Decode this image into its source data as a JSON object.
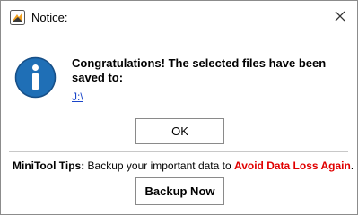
{
  "window": {
    "title": "Notice:"
  },
  "dialog": {
    "message": "Congratulations! The selected files have been saved to:",
    "path": "J:\\",
    "ok_label": "OK"
  },
  "tips": {
    "label": "MiniTool Tips:",
    "text": " Backup your important data to ",
    "highlight": "Avoid Data Loss Again",
    "end": ".",
    "highlight_color": "#e00000"
  },
  "backup_button": {
    "label": "Backup Now"
  },
  "colors": {
    "info_icon": "#1f6fb6",
    "link": "#1a45c9"
  },
  "icons": {
    "app": "app-logo-icon",
    "close": "close-icon",
    "info": "info-icon"
  }
}
